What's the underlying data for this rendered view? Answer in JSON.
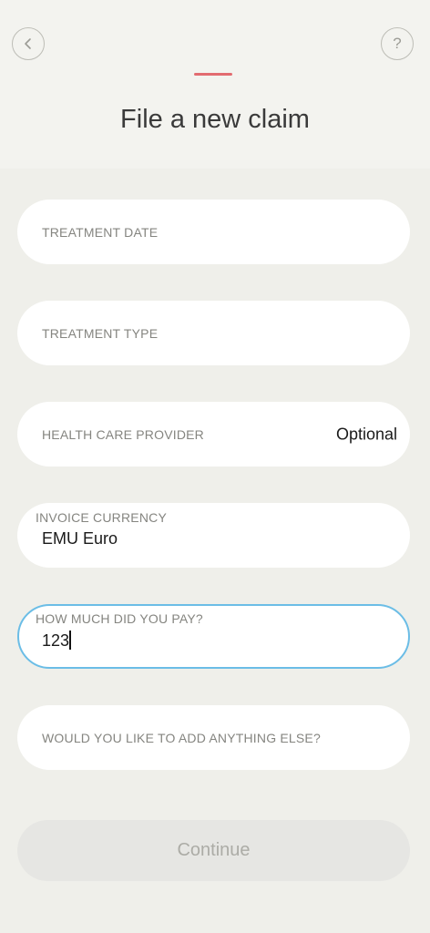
{
  "header": {
    "title": "File a new claim",
    "back_icon": "chevron-left-icon",
    "help_label": "?",
    "accent_color": "#e26b70"
  },
  "form": {
    "treatment_date": {
      "label": "TREATMENT DATE",
      "value": ""
    },
    "treatment_type": {
      "label": "TREATMENT TYPE",
      "value": ""
    },
    "health_care_provider": {
      "label": "HEALTH CARE PROVIDER",
      "hint": "Optional",
      "value": ""
    },
    "invoice_currency": {
      "label": "INVOICE CURRENCY",
      "value": "EMU Euro"
    },
    "amount_paid": {
      "label": "HOW MUCH DID YOU PAY?",
      "value": "123",
      "focused": true,
      "focus_color": "#6bbde6"
    },
    "additional_info": {
      "label": "WOULD YOU LIKE TO ADD ANYTHING ELSE?",
      "value": ""
    }
  },
  "footer": {
    "continue_label": "Continue",
    "continue_enabled": false
  }
}
